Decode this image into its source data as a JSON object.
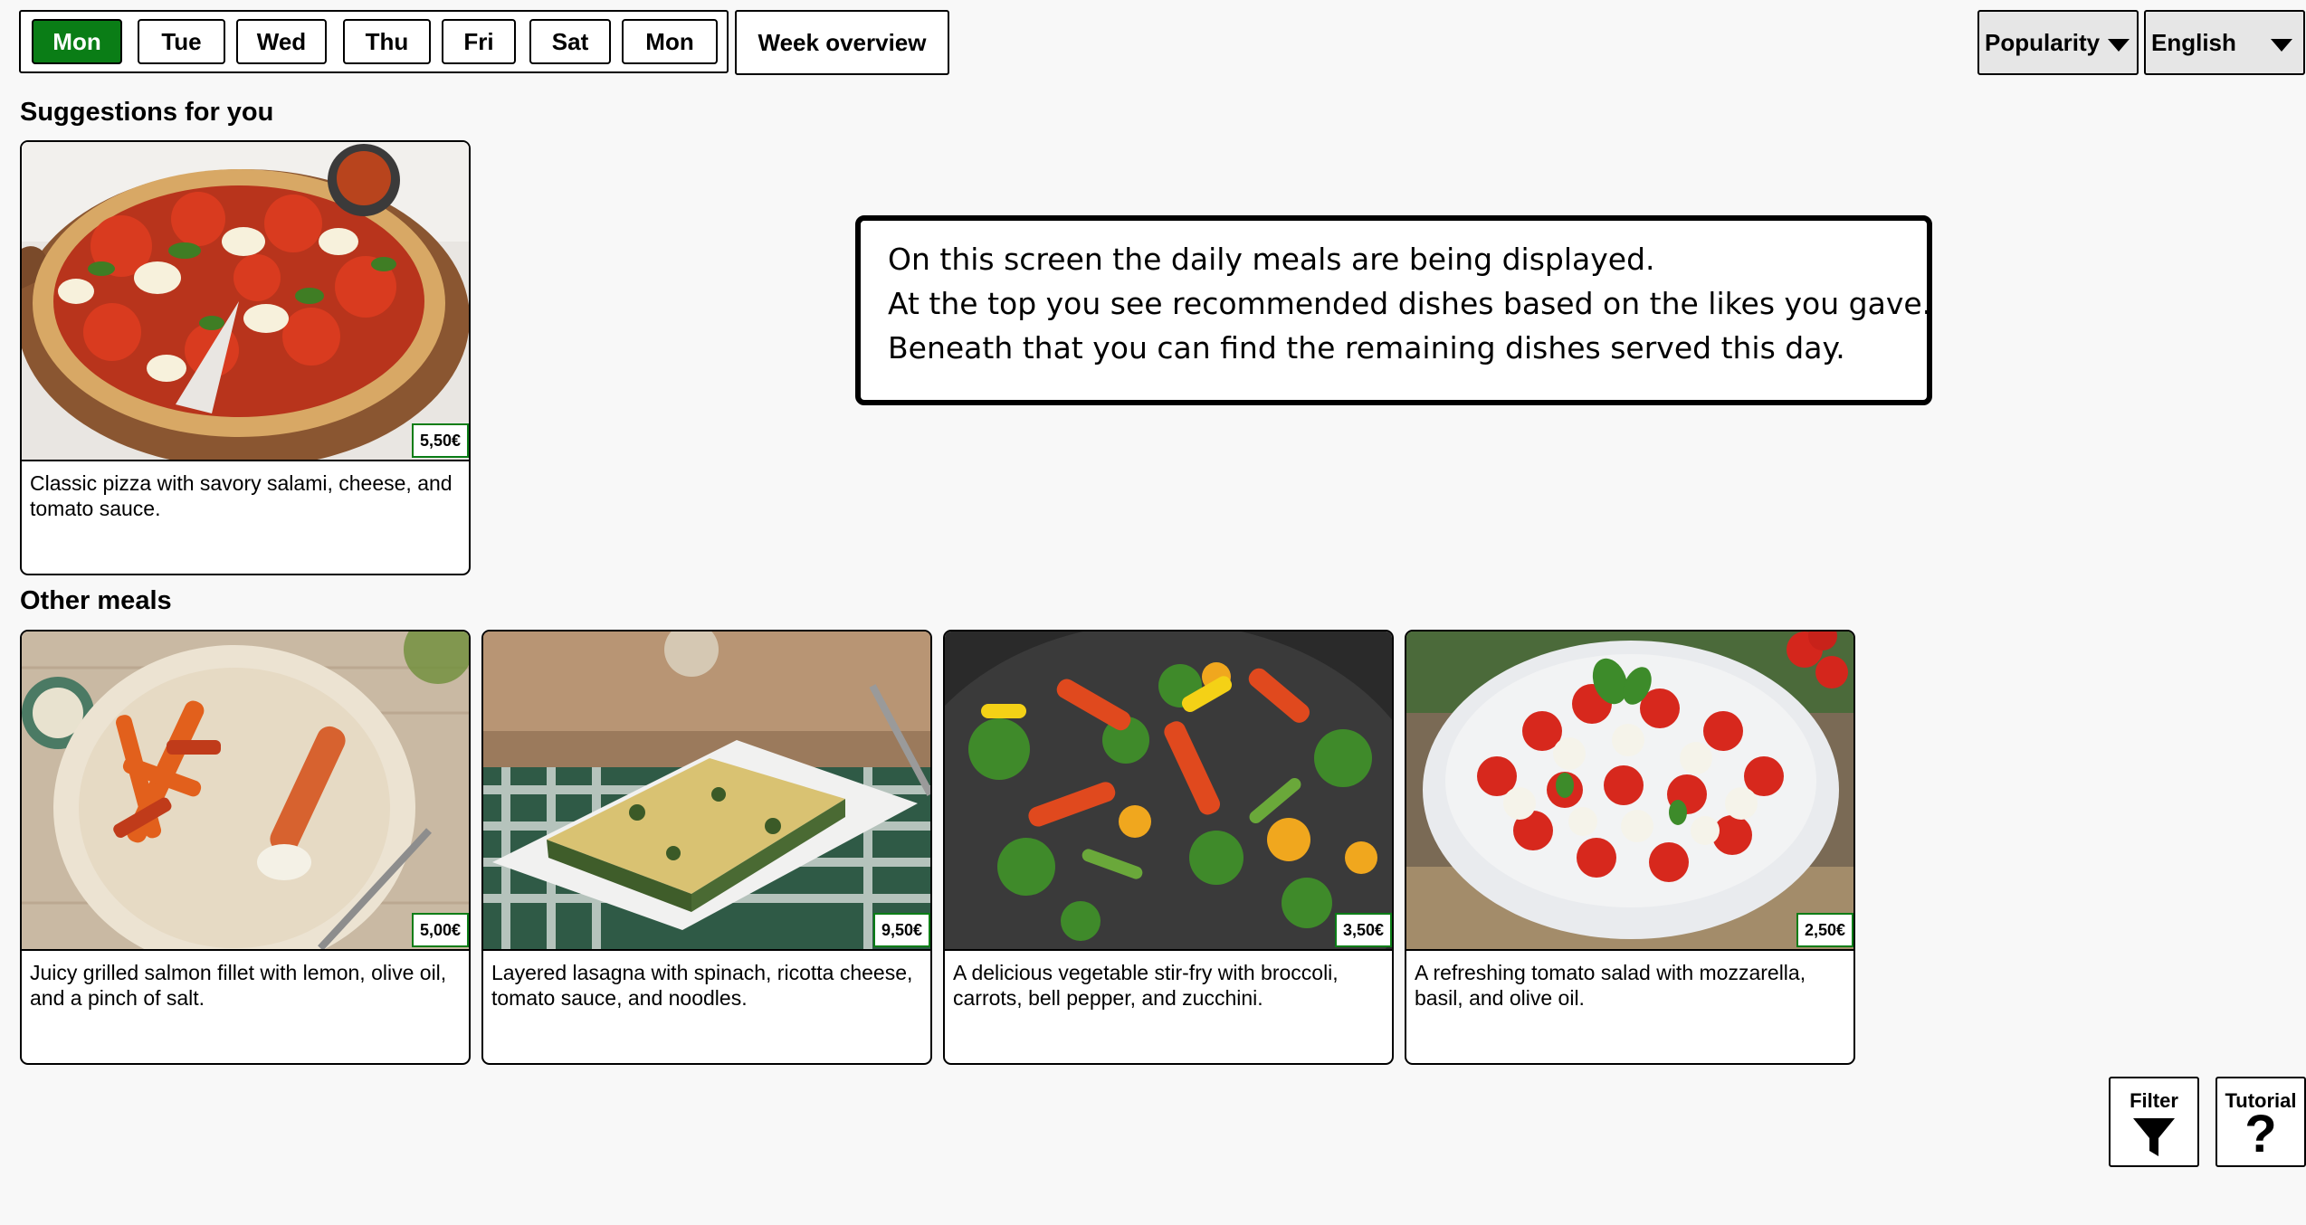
{
  "days": [
    {
      "label": "Mon",
      "active": true
    },
    {
      "label": "Tue",
      "active": false
    },
    {
      "label": "Wed",
      "active": false
    },
    {
      "label": "Thu",
      "active": false
    },
    {
      "label": "Fri",
      "active": false
    },
    {
      "label": "Sat",
      "active": false
    },
    {
      "label": "Mon",
      "active": false
    }
  ],
  "week_overview_label": "Week overview",
  "sort_dropdown": {
    "selected": "Popularity"
  },
  "language_dropdown": {
    "selected": "English"
  },
  "suggestions": {
    "title": "Suggestions for you",
    "meals": [
      {
        "name": "pizza",
        "price": "5,50€",
        "description": "Classic pizza with savory salami, cheese, and tomato sauce."
      }
    ]
  },
  "other": {
    "title": "Other meals",
    "meals": [
      {
        "name": "salmon",
        "price": "5,00€",
        "description": "Juicy grilled salmon fillet with lemon, olive oil, and a pinch of salt."
      },
      {
        "name": "lasagna",
        "price": "9,50€",
        "description": "Layered lasagna with spinach, ricotta cheese, tomato sauce, and noodles."
      },
      {
        "name": "stir-fry",
        "price": "3,50€",
        "description": "A delicious vegetable stir-fry with broccoli, carrots, bell pepper, and zucchini."
      },
      {
        "name": "tomato-salad",
        "price": "2,50€",
        "description": "A refreshing tomato salad with mozzarella, basil, and olive oil."
      }
    ]
  },
  "info": {
    "lines": [
      "On this screen the daily meals are being displayed.",
      "At the top you see recommended dishes based on the likes you gave.",
      "Beneath that you can find the remaining dishes served this day."
    ]
  },
  "filter_button": {
    "label": "Filter",
    "icon": "funnel-icon"
  },
  "tutorial_button": {
    "label": "Tutorial",
    "icon": "question-mark-icon",
    "glyph": "?"
  },
  "colors": {
    "active_day": "#0a7d16",
    "price_border": "#0a7d16"
  }
}
